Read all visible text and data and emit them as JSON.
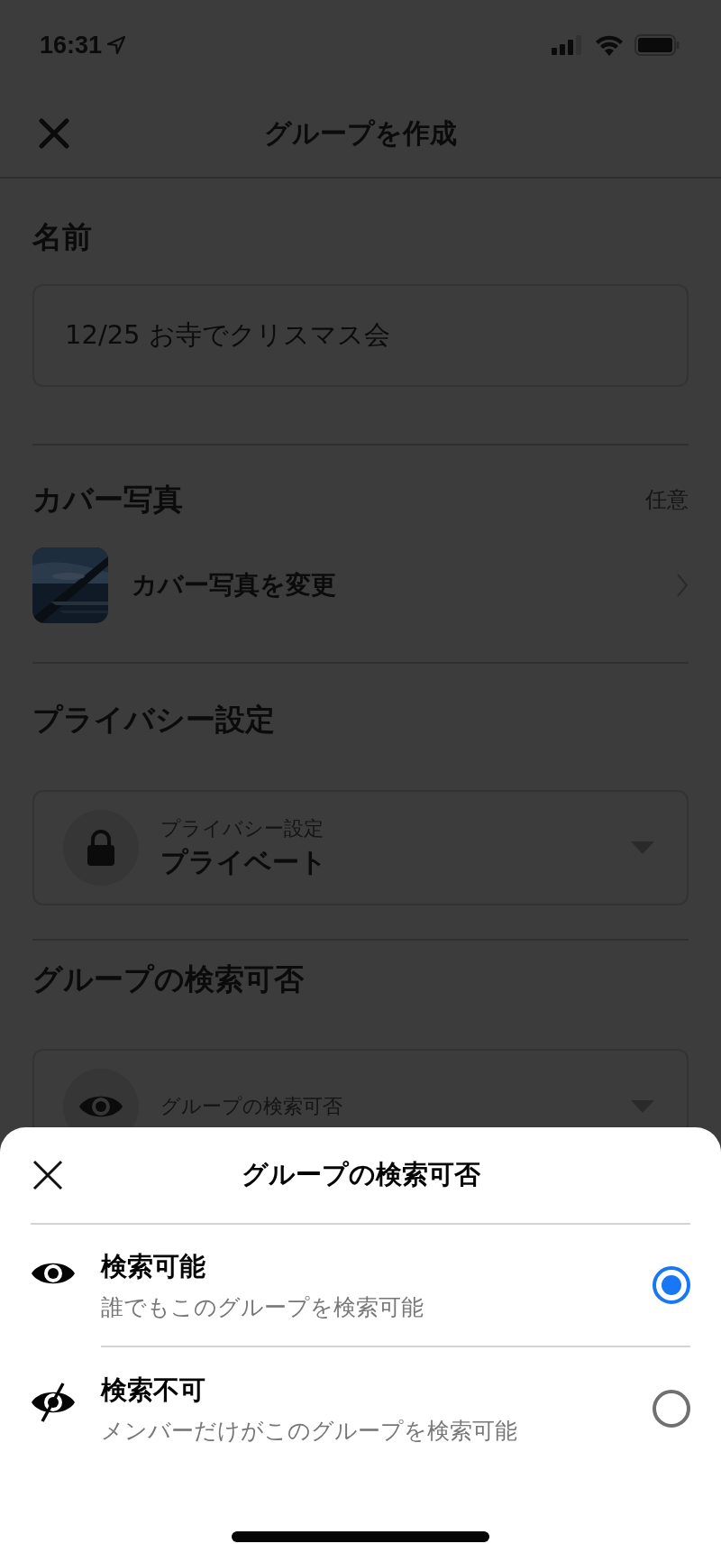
{
  "status_bar": {
    "time": "16:31"
  },
  "header": {
    "title": "グループを作成"
  },
  "name_section": {
    "label": "名前",
    "value": "12/25 お寺でクリスマス会"
  },
  "cover_section": {
    "label": "カバー写真",
    "optional": "任意",
    "action": "カバー写真を変更"
  },
  "privacy_section": {
    "label": "プライバシー設定",
    "select": {
      "caption": "プライバシー設定",
      "value": "プライベート"
    }
  },
  "visibility_section": {
    "label": "グループの検索可否",
    "select": {
      "caption": "グループの検索可否"
    }
  },
  "sheet": {
    "title": "グループの検索可否",
    "options": [
      {
        "kind": "visible",
        "title": "検索可能",
        "description": "誰でもこのグループを検索可能",
        "selected": true
      },
      {
        "kind": "hidden",
        "title": "検索不可",
        "description": "メンバーだけがこのグループを検索可能",
        "selected": false
      }
    ]
  }
}
